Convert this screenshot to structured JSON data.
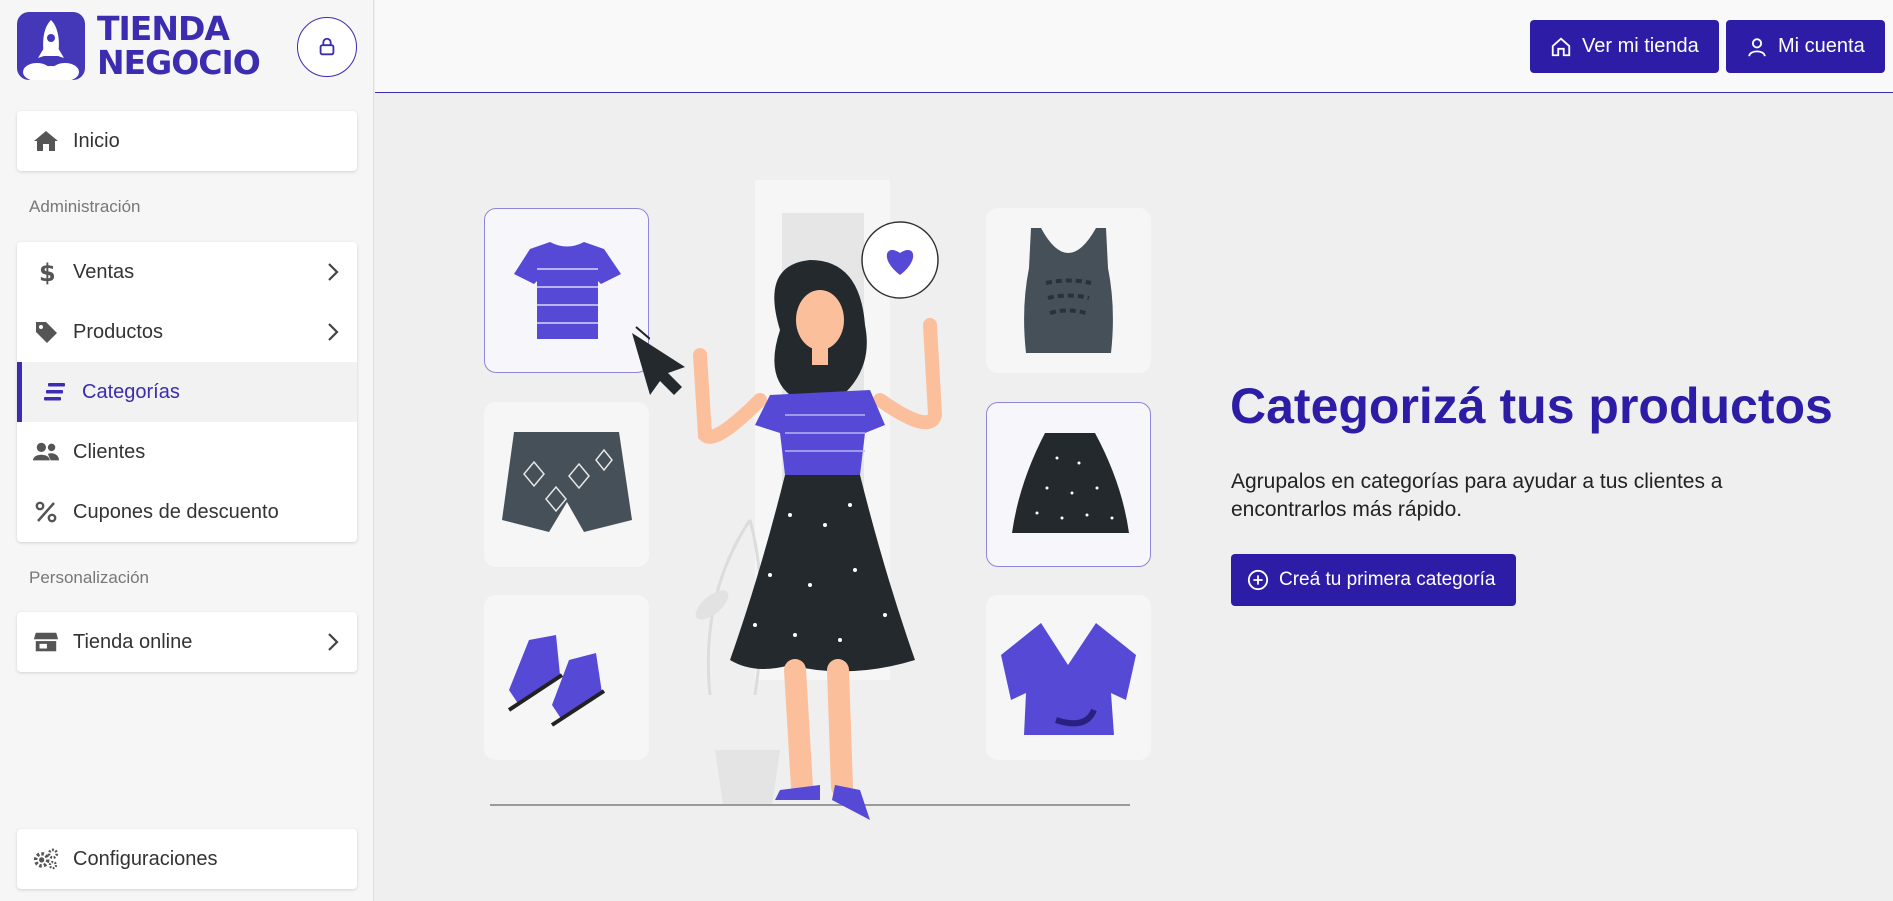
{
  "brand": {
    "line1": "TIENDA",
    "line2": "NEGOCIO",
    "accent": "#3b2cb0"
  },
  "header": {
    "store_button": "Ver mi tienda",
    "account_button": "Mi cuenta"
  },
  "sidebar": {
    "home": "Inicio",
    "section_admin": "Administración",
    "admin_items": [
      {
        "label": "Ventas",
        "icon": "dollar-icon"
      },
      {
        "label": "Productos",
        "icon": "tag-icon"
      },
      {
        "label": "Categorías",
        "icon": "list-icon",
        "active": true
      },
      {
        "label": "Clientes",
        "icon": "users-icon"
      },
      {
        "label": "Cupones de descuento",
        "icon": "percent-icon"
      }
    ],
    "section_custom": "Personalización",
    "online_store": "Tienda online",
    "settings": "Configuraciones"
  },
  "main": {
    "title": "Categorizá tus productos",
    "subtitle": "Agrupalos en categorías para ayudar a tus clientes a encontrarlos más rápido.",
    "cta": "Creá tu primera categoría"
  }
}
